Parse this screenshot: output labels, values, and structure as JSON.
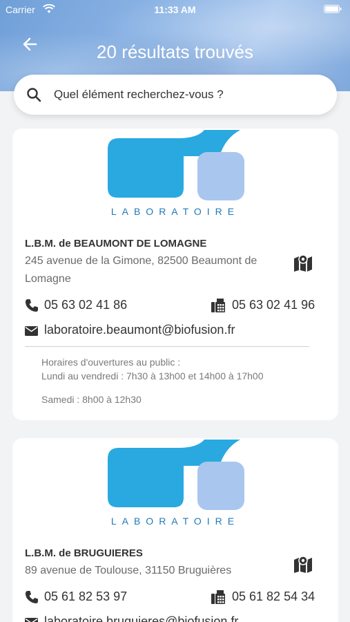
{
  "status_bar": {
    "carrier": "Carrier",
    "time": "11:33 AM"
  },
  "header": {
    "title": "20 résultats trouvés"
  },
  "search": {
    "placeholder": "Quel élément recherchez-vous ?"
  },
  "colors": {
    "accent_blue": "#29a9e0",
    "light_blue": "#a9c7ee",
    "logo_text": "#1f79b7"
  },
  "results": [
    {
      "logo_text": "LABORATOIRE",
      "name": "L.B.M. de BEAUMONT DE LOMAGNE",
      "address": "245 avenue de la Gimone, 82500 Beaumont de Lomagne",
      "phone": "05 63 02 41 86",
      "fax": "05 63 02 41 96",
      "email": "laboratoire.beaumont@biofusion.fr",
      "hours_title": "Horaires d'ouvertures au public :",
      "hours_week": "Lundi au vendredi : 7h30 à 13h00 et 14h00 à 17h00",
      "hours_saturday": "Samedi : 8h00 à 12h30"
    },
    {
      "logo_text": "LABORATOIRE",
      "name": "L.B.M. de BRUGUIERES",
      "address": "89 avenue de Toulouse, 31150 Bruguières",
      "phone": "05 61 82 53 97",
      "fax": "05 61 82 54 34",
      "email": "laboratoire.bruguieres@biofusion.fr"
    }
  ]
}
